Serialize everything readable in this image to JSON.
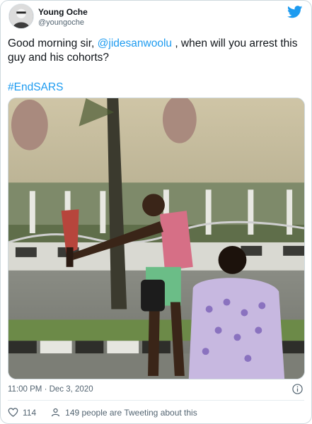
{
  "author": {
    "display_name": "Young Oche",
    "handle": "@youngoche"
  },
  "tweet": {
    "text_before": "Good morning sir, ",
    "mention": "@jidesanwoolu",
    "text_after": " , when will you arrest this guy and his cohorts?",
    "hashtag": "#EndSARS",
    "timestamp": "11:00 PM · Dec 3, 2020"
  },
  "engagement": {
    "likes": "114",
    "tweeting": "149 people are Tweeting about this"
  },
  "colors": {
    "accent": "#1d9bf0",
    "text": "#0f1419",
    "muted": "#536471",
    "like_icon": "#e0245e"
  },
  "icons": {
    "logo": "twitter-bird-icon",
    "info": "info-icon",
    "like": "heart-icon",
    "people": "person-icon"
  }
}
